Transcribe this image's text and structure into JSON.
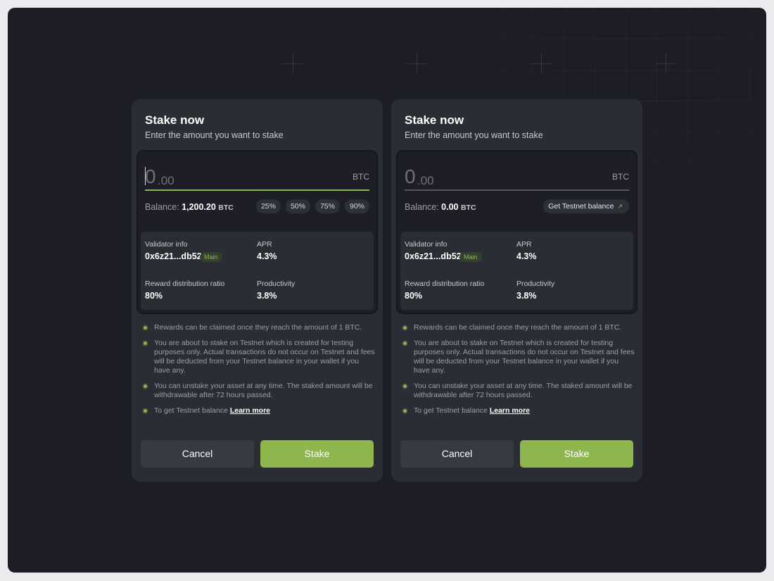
{
  "stake_cards": [
    {
      "title": "Stake now",
      "subtitle": "Enter the amount you want to stake",
      "amount": {
        "integer": "0",
        "decimal": ".00",
        "unit": "BTC"
      },
      "balance": {
        "label": "Balance:",
        "value": "1,200.20",
        "unit": "BTC"
      },
      "percent_options": [
        "25%",
        "50%",
        "75%",
        "90%"
      ],
      "validator": {
        "info_label": "Validator info",
        "address": "0x6z21...db52",
        "tag": "Main",
        "apr_label": "APR",
        "apr_value": "4.3%",
        "ratio_label": "Reward distribution ratio",
        "ratio_value": "80%",
        "productivity_label": "Productivity",
        "productivity_value": "3.8%"
      },
      "notes": [
        "Rewards can be claimed once they reach the amount of 1 BTC.",
        "You are about to stake on Testnet which is created for testing purposes only. Actual transactions do not occur on Testnet and fees will be deducted from your Testnet balance in your wallet if you have any.",
        "You can unstake your asset at any time. The staked amount will be withdrawable after 72 hours passed."
      ],
      "testnet_note": {
        "text": "To get Testnet balance",
        "link": "Learn more"
      },
      "cancel_label": "Cancel",
      "stake_label": "Stake"
    },
    {
      "title": "Stake now",
      "subtitle": "Enter the amount you want to stake",
      "amount": {
        "integer": "0",
        "decimal": ".00",
        "unit": "BTC"
      },
      "balance": {
        "label": "Balance:",
        "value": "0.00",
        "unit": "BTC"
      },
      "testnet_button": {
        "label": "Get Testnet balance",
        "icon": "arrow-up-right-icon"
      },
      "validator": {
        "info_label": "Validator info",
        "address": "0x6z21...db52",
        "tag": "Main",
        "apr_label": "APR",
        "apr_value": "4.3%",
        "ratio_label": "Reward distribution ratio",
        "ratio_value": "80%",
        "productivity_label": "Productivity",
        "productivity_value": "3.8%"
      },
      "notes": [
        "Rewards can be claimed once they reach the amount of 1 BTC.",
        "You are about to stake on Testnet which is created for testing purposes only. Actual transactions do not occur on Testnet and fees will be deducted from your Testnet balance in your wallet if you have any.",
        "You can unstake your asset at any time. The staked amount will be withdrawable after 72 hours passed."
      ],
      "testnet_note": {
        "text": "To get Testnet balance",
        "link": "Learn more"
      },
      "cancel_label": "Cancel",
      "stake_label": "Stake"
    }
  ],
  "colors": {
    "accent": "#8fb54e",
    "background": "#1d1e25",
    "card": "#2b2d35"
  }
}
